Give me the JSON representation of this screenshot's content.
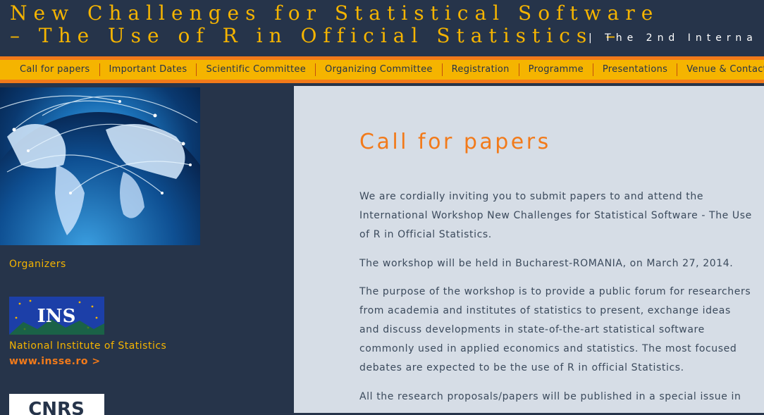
{
  "header": {
    "title_line1": "New Challenges for Statistical Software",
    "title_line2": "– The Use of R in Official Statistics –",
    "subtitle": "| The 2nd Interna"
  },
  "nav": {
    "items": [
      "Call for papers",
      "Important Dates",
      "Scientific Committee",
      "Organizing Committee",
      "Registration",
      "Programme",
      "Presentations",
      "Venue & Contact"
    ]
  },
  "sidebar": {
    "heading": "Organizers",
    "org1_name": "National Institute of Statistics",
    "org1_link": "www.insse.ro >",
    "logo1_text": "INS",
    "logo2_text": "CNRS"
  },
  "main": {
    "title": "Call for papers",
    "paragraphs": [
      "We are cordially inviting you to submit papers to and attend the International Workshop New Challenges for Statistical Software - The Use of R in Official Statistics.",
      "The workshop will be held in Bucharest-ROMANIA, on March 27, 2014.",
      "The purpose of the workshop is to provide a public forum for researchers from academia and institutes of statistics to present, exchange ideas and discuss developments in state-of-the-art statistical software commonly used in applied economics and statistics. The most focused debates are expected to be the use of R in official Statistics.",
      "All the research proposals/papers will be published in a special issue in"
    ]
  },
  "colors": {
    "background": "#26344a",
    "accent_yellow": "#f5b400",
    "accent_orange": "#f27a1a",
    "content_bg": "#d6dde6",
    "text": "#3b4a5c"
  }
}
